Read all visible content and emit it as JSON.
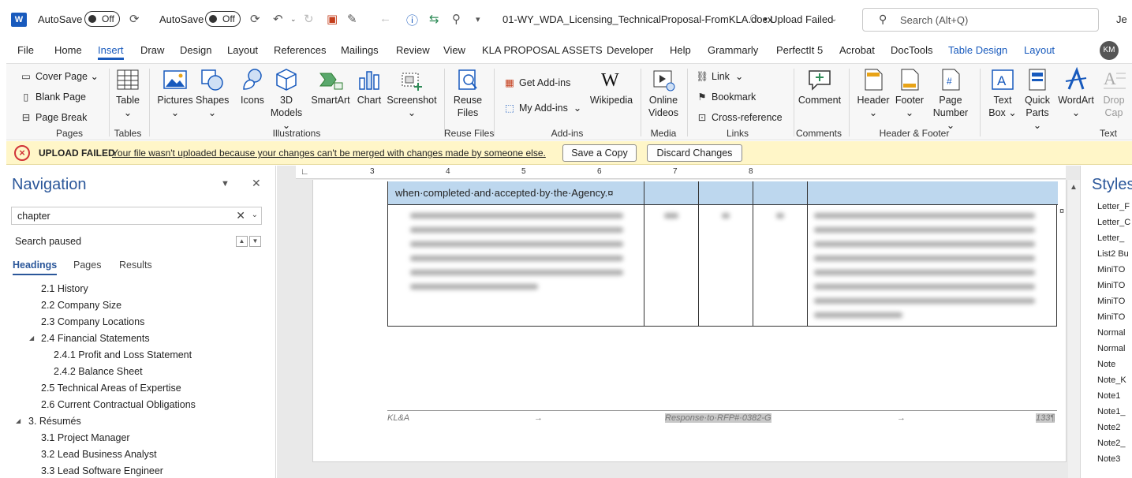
{
  "titlebar": {
    "app_letter": "W",
    "autosave_label_1": "AutoSave",
    "autosave_state_1": "Off",
    "autosave_label_2": "AutoSave",
    "autosave_state_2": "Off",
    "filename": "01-WY_WDA_Licensing_TechnicalProposal-FromKLA.docx",
    "upload_status": "• Upload Failed",
    "search_placeholder": "Search (Alt+Q)",
    "user_initials_partial": "Je"
  },
  "tabs": [
    "File",
    "Home",
    "Insert",
    "Draw",
    "Design",
    "Layout",
    "References",
    "Mailings",
    "Review",
    "View",
    "KLA PROPOSAL ASSETS",
    "Developer",
    "Help",
    "Grammarly",
    "PerfectIt 5",
    "Acrobat",
    "DocTools",
    "Table Design",
    "Layout"
  ],
  "active_tab": "Insert",
  "avatar": "KM",
  "ribbon": {
    "pages": {
      "label": "Pages",
      "cover_page": "Cover Page",
      "blank_page": "Blank Page",
      "page_break": "Page Break"
    },
    "tables": {
      "label": "Tables",
      "table": "Table"
    },
    "illustrations": {
      "label": "Illustrations",
      "pictures": "Pictures",
      "shapes": "Shapes",
      "icons": "Icons",
      "models_3d_1": "3D",
      "models_3d_2": "Models",
      "smartart": "SmartArt",
      "chart": "Chart",
      "screenshot": "Screenshot"
    },
    "reuse": {
      "label": "Reuse Files",
      "reuse_1": "Reuse",
      "reuse_2": "Files"
    },
    "addins": {
      "label": "Add-ins",
      "get_addins": "Get Add-ins",
      "my_addins": "My Add-ins",
      "wikipedia": "Wikipedia"
    },
    "media": {
      "label": "Media",
      "online_1": "Online",
      "online_2": "Videos"
    },
    "links": {
      "label": "Links",
      "link": "Link",
      "bookmark": "Bookmark",
      "cross_ref": "Cross-reference"
    },
    "comments": {
      "label": "Comments",
      "comment": "Comment"
    },
    "header_footer": {
      "label": "Header & Footer",
      "header": "Header",
      "footer": "Footer",
      "page_number_1": "Page",
      "page_number_2": "Number"
    },
    "text": {
      "label": "Text",
      "textbox_1": "Text",
      "textbox_2": "Box",
      "quickparts_1": "Quick",
      "quickparts_2": "Parts",
      "wordart": "WordArt",
      "dropcap_1": "Drop",
      "dropcap_2": "Cap"
    }
  },
  "msgbar": {
    "title": "UPLOAD FAILED",
    "message": "Your file wasn't uploaded because your changes can't be merged with changes made by someone else.",
    "save_copy": "Save a Copy",
    "discard": "Discard Changes"
  },
  "nav": {
    "title": "Navigation",
    "search_value": "chapter",
    "status": "Search paused",
    "tabs": [
      "Headings",
      "Pages",
      "Results"
    ],
    "items": [
      "2.1 History",
      "2.2 Company Size",
      "2.3 Company Locations",
      "2.4 Financial Statements",
      "2.4.1 Profit and Loss Statement",
      "2.4.2 Balance Sheet",
      "2.5 Technical Areas of Expertise",
      "2.6 Current Contractual Obligations",
      "3. Résumés",
      "3.1 Project Manager",
      "3.2 Lead Business Analyst",
      "3.3 Lead Software Engineer"
    ]
  },
  "ruler": {
    "numbers": [
      "3",
      "4",
      "5",
      "6",
      "7",
      "8"
    ]
  },
  "document": {
    "cell_text": "when·completed·and·accepted·by·the·Agency.¤",
    "cell_mark": "¤",
    "footer_left": "KL&A",
    "footer_arrow": "→",
    "footer_center": "Response·to·RFP#·0382-G",
    "footer_page": "133¶"
  },
  "styles": {
    "title": "Styles",
    "items": [
      "Letter_F",
      "Letter_C",
      "Letter_",
      "List2 Bu",
      "MiniTO",
      "MiniTO",
      "MiniTO",
      "MiniTO",
      "Normal",
      "Normal",
      "Note",
      "Note_K",
      "Note1",
      "Note1_",
      "Note2",
      "Note2_",
      "Note3"
    ]
  }
}
